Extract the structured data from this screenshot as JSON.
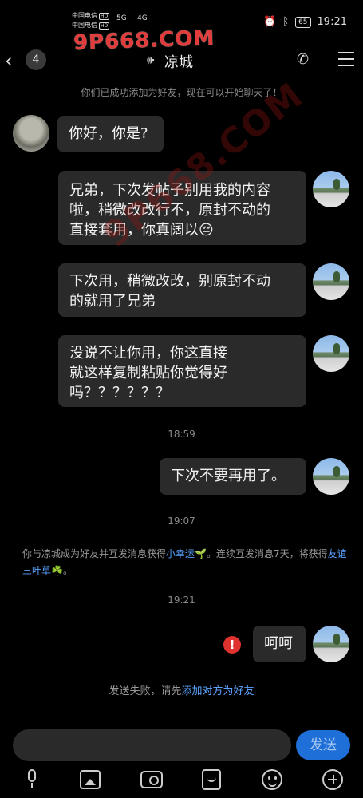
{
  "status_bar": {
    "carrier1": "中国电信",
    "carrier1_badge": "HD",
    "carrier2": "中国电信",
    "carrier2_badge": "HD",
    "signal1": "5G",
    "signal2": "4G",
    "battery": "65",
    "time": "19:21"
  },
  "watermark": {
    "top": "9P668.COM",
    "diagonal": "9P668.COM"
  },
  "nav": {
    "unread_count": "4",
    "title": "凉城"
  },
  "system_hint": "你们已成功添加为好友，现在可以开始聊天了！",
  "messages": [
    {
      "text": "你好，你是?"
    },
    {
      "text": "兄弟，下次发帖子别用我的内容\n啦，稍微改改行不，原封不动的\n直接套用，你真阔以😔"
    },
    {
      "text": "下次用，稍微改改，别原封不动\n的就用了兄弟"
    },
    {
      "text": "没说不让你用，你这直接\n就这样复制粘贴你觉得好\n吗？？？？？？"
    },
    {
      "text": "下次不要再用了。"
    },
    {
      "text": "呵呵"
    }
  ],
  "timestamps": [
    "18:59",
    "19:07",
    "19:21"
  ],
  "notice": {
    "part1": "你与凉城成为好友并互发消息获得",
    "link1": "小幸运🌱",
    "part2": "。连续互发消息7天，将获得",
    "link2": "友谊三叶草☘️",
    "part3": "。"
  },
  "send_fail": {
    "text": "发送失败，请先",
    "link": "添加对方为好友"
  },
  "input": {
    "send_label": "发送"
  }
}
